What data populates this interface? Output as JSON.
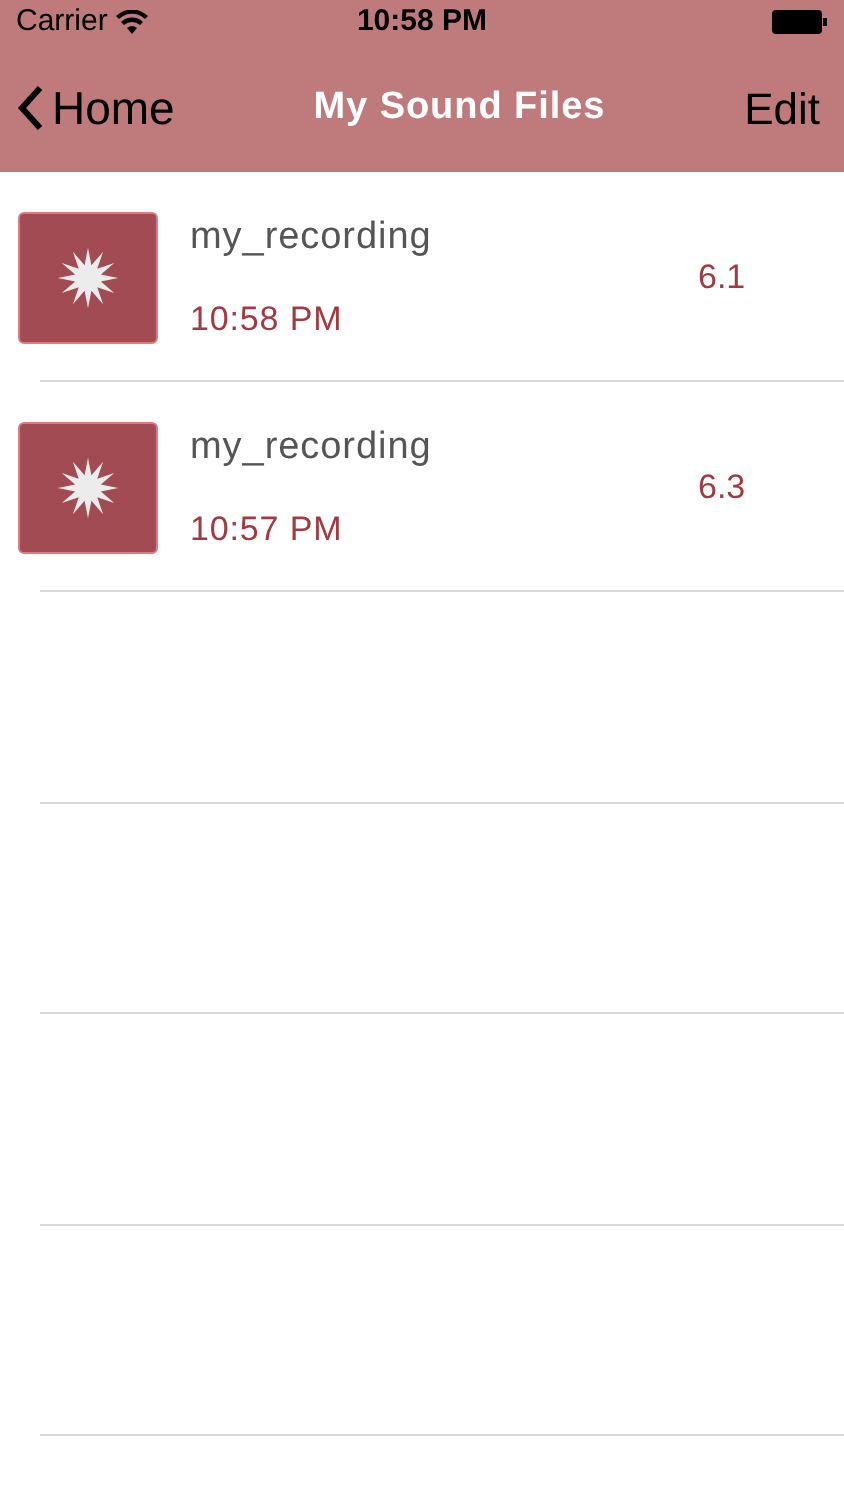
{
  "status_bar": {
    "carrier": "Carrier",
    "time": "10:58 PM"
  },
  "nav_bar": {
    "back": "Home",
    "title": "My Sound Files",
    "action": "Edit"
  },
  "files": [
    {
      "name": "my_recording",
      "time": "10:58 PM",
      "value": "6.1"
    },
    {
      "name": "my_recording",
      "time": "10:57 PM",
      "value": "6.3"
    }
  ]
}
